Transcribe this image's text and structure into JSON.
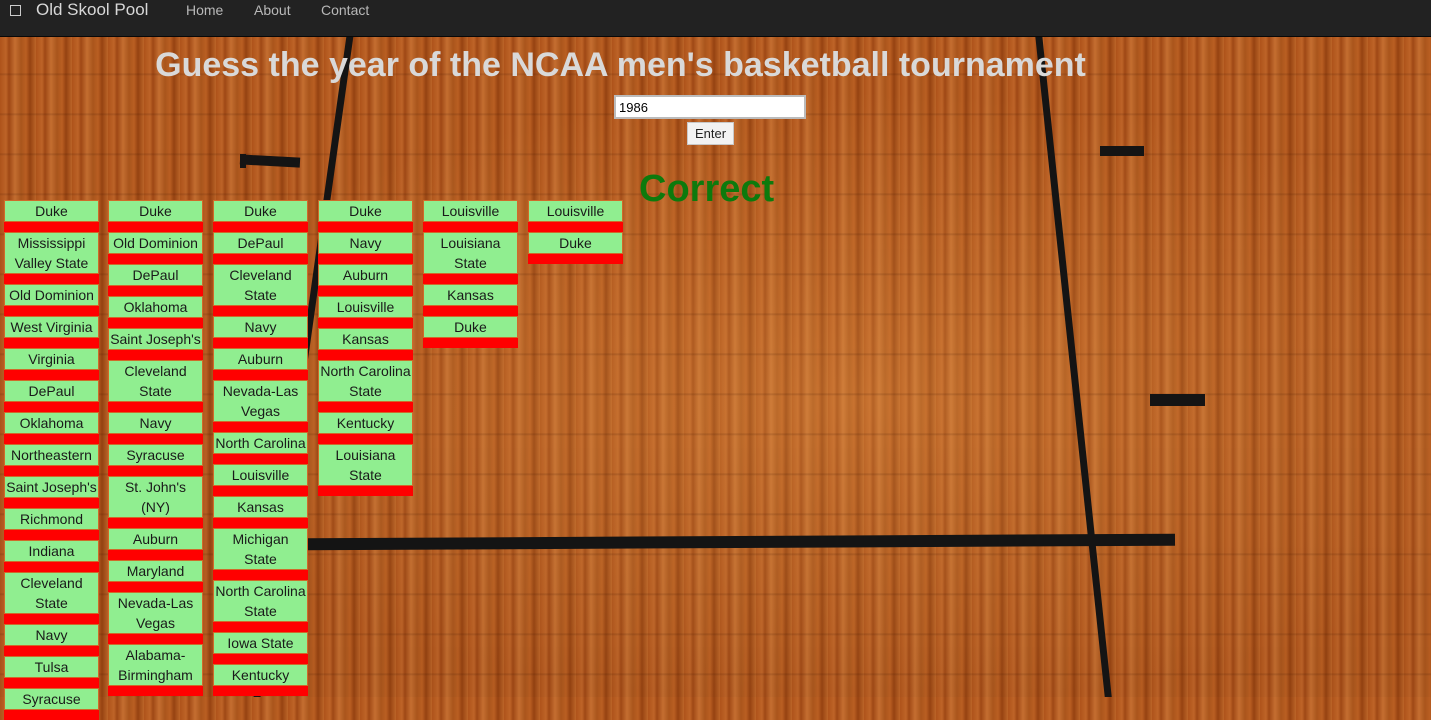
{
  "navbar": {
    "brand": "Old Skool Pool",
    "links": [
      "Home",
      "About",
      "Contact"
    ]
  },
  "page": {
    "title": "Guess the year of the NCAA men's basketball tournament",
    "year_input_value": "1986",
    "enter_label": "Enter",
    "result_text": "Correct",
    "result_color": "#0d7a0d"
  },
  "colors": {
    "team_bg": "#90ee90",
    "separator": "#ff0000",
    "navbar": "#222222"
  },
  "bracket": {
    "rounds": [
      [
        "Duke",
        "Mississippi Valley State",
        "Old Dominion",
        "West Virginia",
        "Virginia",
        "DePaul",
        "Oklahoma",
        "Northeastern",
        "Saint Joseph's",
        "Richmond",
        "Indiana",
        "Cleveland State",
        "Navy",
        "Tulsa",
        "Syracuse"
      ],
      [
        "Duke",
        "Old Dominion",
        "DePaul",
        "Oklahoma",
        "Saint Joseph's",
        "Cleveland State",
        "Navy",
        "Syracuse",
        "St. John's (NY)",
        "Auburn",
        "Maryland",
        "Nevada-Las Vegas",
        "Alabama-Birmingham"
      ],
      [
        "Duke",
        "DePaul",
        "Cleveland State",
        "Navy",
        "Auburn",
        "Nevada-Las Vegas",
        "North Carolina",
        "Louisville",
        "Kansas",
        "Michigan State",
        "North Carolina State",
        "Iowa State",
        "Kentucky"
      ],
      [
        "Duke",
        "Navy",
        "Auburn",
        "Louisville",
        "Kansas",
        "North Carolina State",
        "Kentucky",
        "Louisiana State"
      ],
      [
        "Louisville",
        "Louisiana State",
        "Kansas",
        "Duke"
      ],
      [
        "Louisville",
        "Duke"
      ]
    ]
  }
}
